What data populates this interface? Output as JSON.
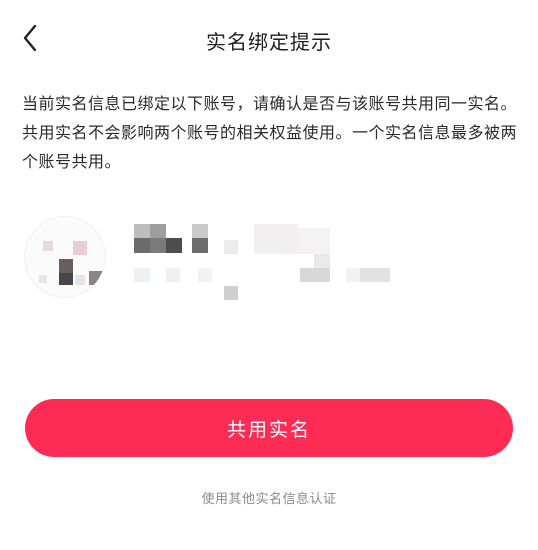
{
  "header": {
    "back_icon": "chevron-left-icon",
    "title": "实名绑定提示"
  },
  "notice": {
    "text": "当前实名信息已绑定以下账号，请确认是否与该账号共用同一实名。共用实名不会影响两个账号的相关权益使用。一个实名信息最多被两个账号共用。"
  },
  "account": {
    "obscured": true
  },
  "actions": {
    "share_label": "共用实名",
    "other_label": "使用其他实名信息认证"
  },
  "colors": {
    "accent": "#fe2c55",
    "text_primary": "#1f1f1f",
    "text_secondary": "#8a8a8a"
  }
}
